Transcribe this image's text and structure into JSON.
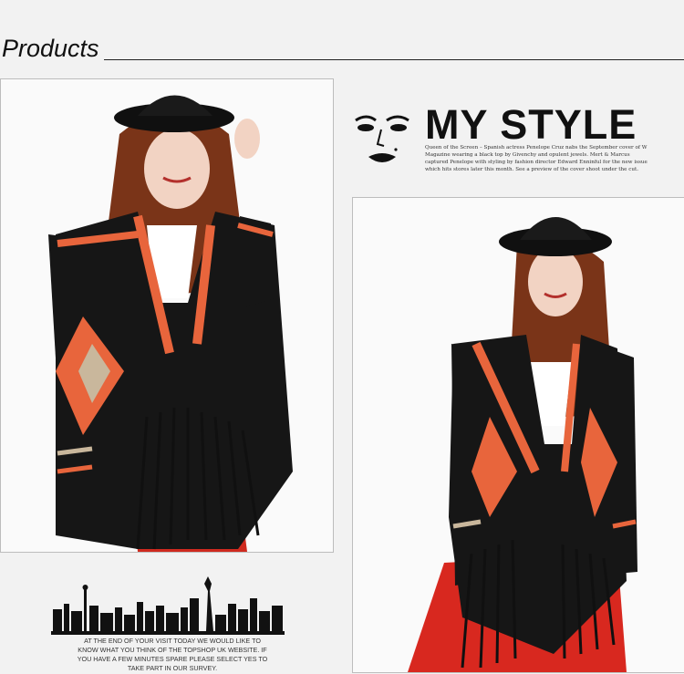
{
  "header": {
    "title": "Products"
  },
  "brand": {
    "title": "MY STYLE",
    "text": "Queen of the Screen – Spanish actress Penelope Cruz nabs the September cover of W Magazine wearing a black top by Givenchy and opulent jewels. Mert & Marcus captured Penelope with styling by fashion director Edward Enninful for the new issue which hits stores later this month. See a preview of the cover shoot under the cut."
  },
  "footer": {
    "text": "AT THE END OF YOUR VISIT TODAY WE WOULD LIKE TO KNOW WHAT YOU THINK OF THE TOPSHOP UK WEBSITE. IF YOU HAVE A FEW MINUTES SPARE PLEASE SELECT YES TO TAKE PART IN OUR SURVEY."
  },
  "colors": {
    "accent": "#e8653c",
    "cardigan": "#161616",
    "pants": "#d8281f",
    "hair": "#7a3418"
  }
}
